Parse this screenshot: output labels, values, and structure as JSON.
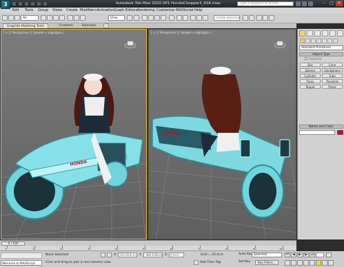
{
  "window": {
    "title": "Autodesk 3ds Max  2010 SP1    HondaChopper3_KSK.max",
    "logo_text": "3"
  },
  "search": {
    "placeholder": "Type a keyword or phrase"
  },
  "menu": [
    "Edit",
    "Tools",
    "Group",
    "Views",
    "Create",
    "Modifiers",
    "Animation",
    "Graph Editors",
    "Rendering",
    "Customize",
    "MAXScript",
    "Help"
  ],
  "toolbar": {
    "selection_filter": "All",
    "reference_coord": "View",
    "named_selection": "Create Selection Se"
  },
  "ribbon": {
    "tabs": [
      "Graphite Modeling Tools",
      "Freeform",
      "Selection"
    ]
  },
  "viewports": {
    "left_label": "[ + ] [ Perspective ] [ Smooth + Highlights ]",
    "right_label": "[ + ] [ Perspective ] [ Smooth + Highlights ]"
  },
  "command_panel": {
    "category": "Standard Primitives",
    "object_type_header": "Object Type",
    "autogrid_label": "AutoGrid",
    "objects": [
      "Box",
      "Cone",
      "Sphere",
      "GeoSphere",
      "Cylinder",
      "Tube",
      "Torus",
      "Pyramid",
      "Teapot",
      "Plane"
    ],
    "name_color_header": "Name and Color",
    "accent_color": "#b0103a"
  },
  "timeline": {
    "frame_readout": "0 / 100",
    "ticks": [
      "0",
      "10",
      "20",
      "30",
      "40",
      "50",
      "60",
      "70",
      "80",
      "90",
      "100"
    ]
  },
  "status": {
    "listener_text": "Welcome to MAXScript.",
    "selection": "None Selected",
    "prompt": "Click and drag to pan a non-camera view",
    "x_label": "X:",
    "x_value": "252.813cm",
    "y_label": "Y:",
    "y_value": "-480.638cm",
    "z_label": "Z:",
    "z_value": "0.0cm",
    "grid": "Grid = 25.4cm",
    "add_time_tag": "Add Time Tag",
    "auto_key": "Auto Key",
    "set_key": "Set Key",
    "key_mode": "Selected",
    "key_filters": "Key Filters..."
  }
}
